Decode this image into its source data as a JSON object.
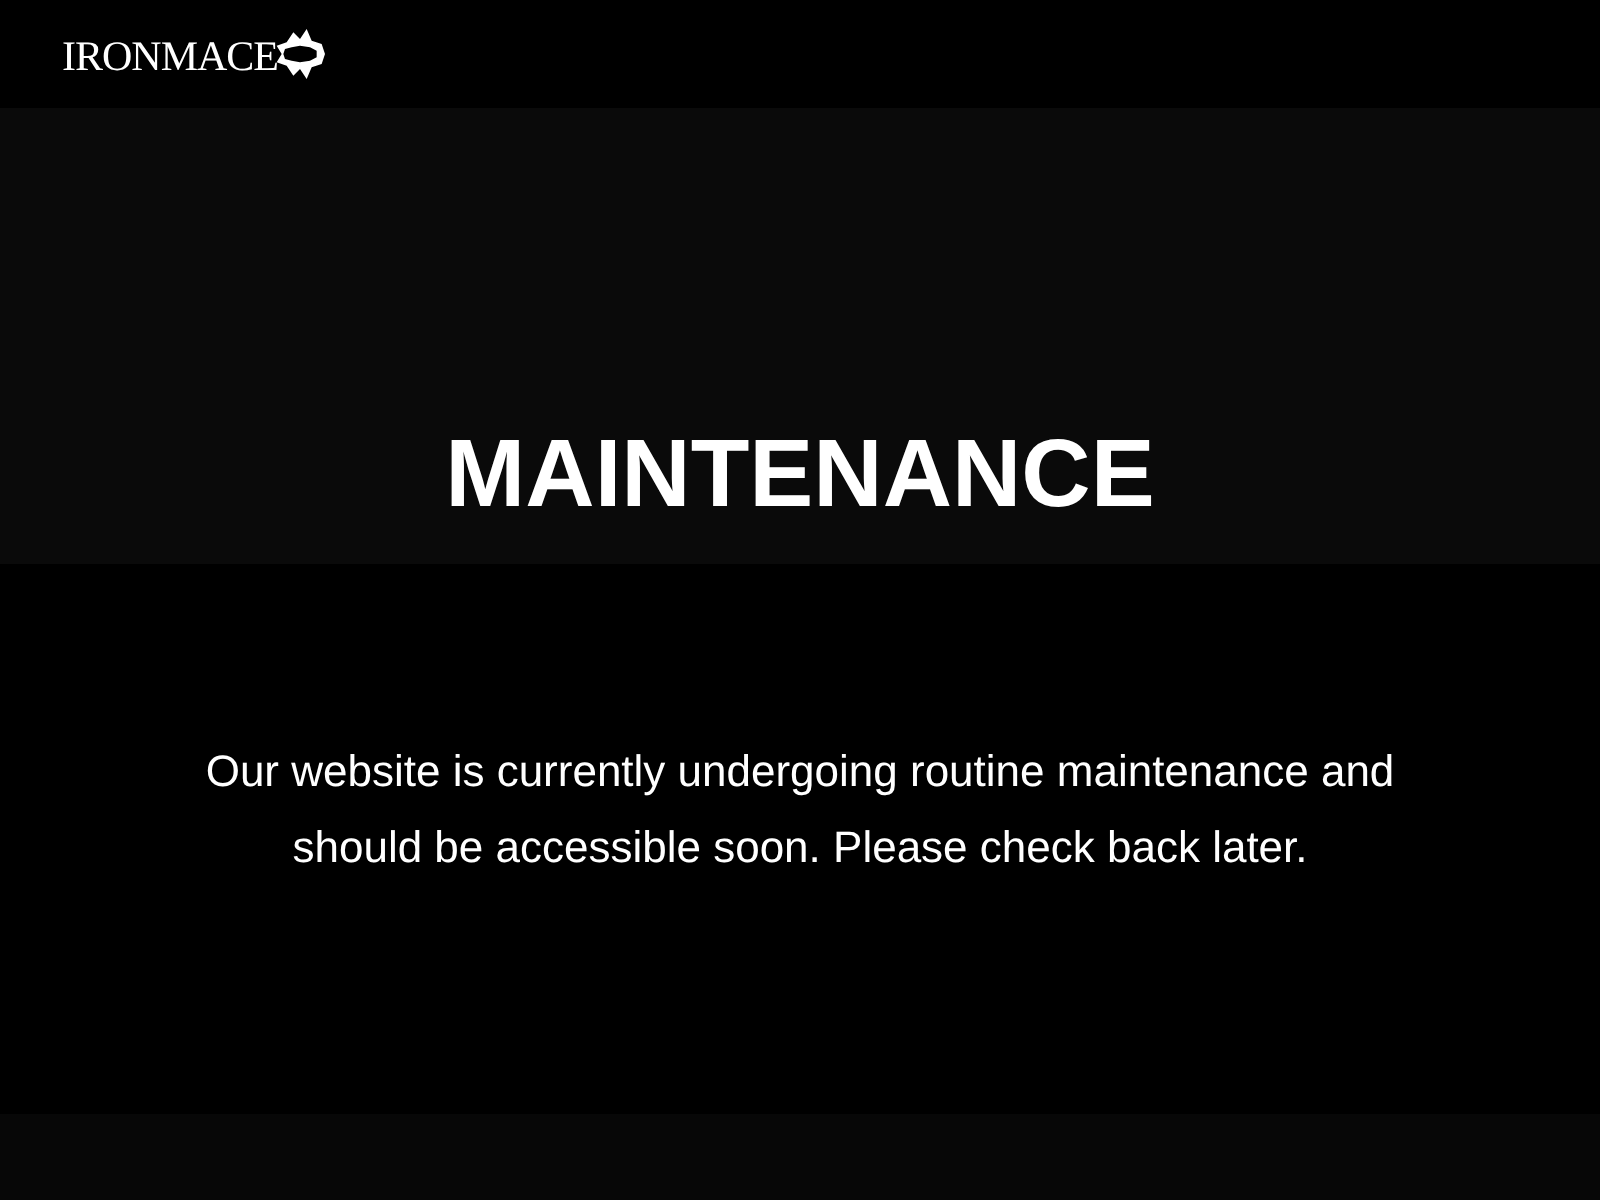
{
  "header": {
    "logo": {
      "text": "IRONMACE"
    }
  },
  "hero": {
    "title": "MAINTENANCE"
  },
  "message": {
    "text": "Our website is currently undergoing routine maintenance and should be accessible soon. Please check back later."
  }
}
